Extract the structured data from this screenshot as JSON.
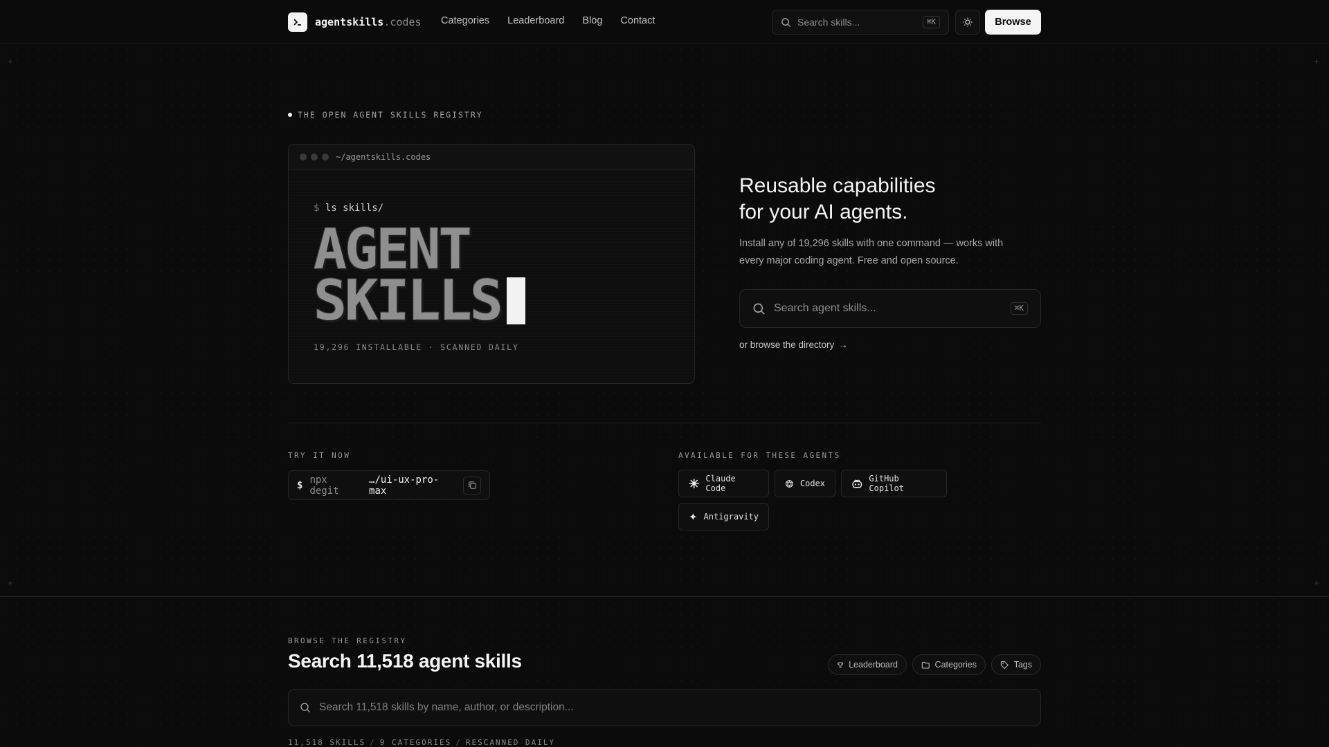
{
  "header": {
    "brand_name": "agentskills",
    "brand_tld": ".codes",
    "nav": [
      "Categories",
      "Leaderboard",
      "Blog",
      "Contact"
    ],
    "search_placeholder": "Search skills...",
    "search_shortcut": "⌘K",
    "browse_label": "Browse"
  },
  "hero": {
    "eyebrow": "THE OPEN AGENT SKILLS REGISTRY",
    "terminal": {
      "path": "~/agentskills.codes",
      "prompt": "$",
      "command": "ls skills/",
      "line1": "AGENT",
      "line2": "SKILLS",
      "stats": "19,296 INSTALLABLE · SCANNED DAILY"
    },
    "title_line1": "Reusable capabilities",
    "title_line2": "for your AI agents.",
    "description": "Install any of 19,296 skills with one command — works with every major coding agent. Free and open source.",
    "search_placeholder": "Search agent skills...",
    "search_shortcut": "⌘K",
    "browse_link": "or browse the directory",
    "link_arrow": "→"
  },
  "try_it": {
    "label": "TRY IT NOW",
    "prompt": "$",
    "command_prefix": "npx degit",
    "command_package": "…/ui-ux-pro-max"
  },
  "agents": {
    "label": "AVAILABLE FOR THESE AGENTS",
    "items": [
      {
        "name": "Claude Code",
        "icon": "claude-icon"
      },
      {
        "name": "Codex",
        "icon": "openai-icon"
      },
      {
        "name": "GitHub Copilot",
        "icon": "copilot-icon"
      },
      {
        "name": "Antigravity",
        "icon": "sparkle-icon"
      }
    ]
  },
  "browse": {
    "eyebrow": "BROWSE THE REGISTRY",
    "title": "Search 11,518 agent skills",
    "pills": [
      "Leaderboard",
      "Categories",
      "Tags"
    ],
    "search_placeholder": "Search 11,518 skills by name, author, or description...",
    "stats": [
      "11,518 SKILLS",
      "9 CATEGORIES",
      "RESCANNED DAILY"
    ],
    "stats_separator": "/"
  },
  "colors": {
    "background": "#0b0b0b",
    "text": "#ededed",
    "muted": "#a3a3a3",
    "border": "#262626",
    "button": "#f5f5f5"
  }
}
